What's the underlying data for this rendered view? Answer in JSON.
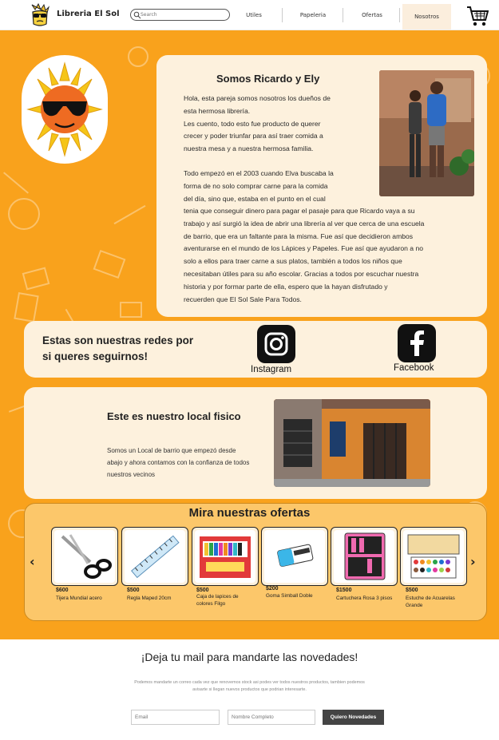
{
  "header": {
    "brand": "Libreria El Sol",
    "search_placeholder": "Search",
    "nav": [
      "Utiles",
      "Papeleria",
      "Ofertas",
      "Nosotros"
    ],
    "active_nav": "Nosotros",
    "icons": {
      "logo": "sunglasses-face-logo",
      "search": "search-icon",
      "cart": "shopping-cart-icon"
    }
  },
  "about": {
    "title": "Somos Ricardo y Ely",
    "para1": "Hola, esta pareja somos nosotros los dueños de\nesta hermosa librería.\nLes cuento, todo esto fue producto de querer\ncrecer y poder triunfar para así traer comida a\nnuestra mesa y a nuestra hermosa familia.",
    "para2_narrow": "Todo empezó en el 2003 cuando Elva buscaba la\nforma de no solo comprar carne para la comida\ndel día, sino que, estaba en el punto en el cual",
    "para2_wide": "tenia que conseguir dinero para pagar el pasaje para que Ricardo vaya a su\ntrabajo y así surgió la idea de abrir una librería al ver que cerca de una escuela\nde barrio, que era un faltante para la misma. Fue así que decidieron ambos\naventurarse en el mundo de los Lápices y Papeles. Fue así que ayudaron a no\nsolo a ellos para traer carne a sus platos, también a todos los niños que\nnecesitaban útiles para su año escolar. Gracias a todos por escuchar nuestra\nhistoria y por formar parte de ella, espero que la hayan disfrutado y\nrecuerden que El Sol Sale Para Todos."
  },
  "social": {
    "title": "Estas son nuestras redes por si queres seguirnos!",
    "instagram": "Instagram",
    "facebook": "Facebook"
  },
  "local": {
    "title": "Este es nuestro local fisico",
    "text": "Somos un Local de barrio que empezó desde abajo y ahora contamos con la confianza de todos nuestros vecinos"
  },
  "offers": {
    "title": "Mira nuestras ofertas",
    "products": [
      {
        "price": "$600",
        "name": "Tijera Mundial acero"
      },
      {
        "price": "$500",
        "name": "Regla Maped 20cm"
      },
      {
        "price": "$500",
        "name": "Caja de lapices de colores Filgo"
      },
      {
        "price": "$200",
        "name": "Goma Simball Doble"
      },
      {
        "price": "$1500",
        "name": "Cartuchera Rosa 3 pisos"
      },
      {
        "price": "$500",
        "name": "Estuche de Acuarelas Grande"
      }
    ]
  },
  "newsletter": {
    "title": "¡Deja tu mail para mandarte las novedades!",
    "text": "Podemos mandarte un correo cada vez que renovemos stock asi podes ver todos nuestros productos, tambien podemos avisarte si llegan nuevos productos que podrian interesarte.",
    "email_placeholder": "Email",
    "name_placeholder": "Nombre Completo",
    "button": "Quiero Novedades"
  },
  "colors": {
    "accent": "#f9a21c",
    "panel": "#fdf1dd",
    "button": "#444444"
  }
}
